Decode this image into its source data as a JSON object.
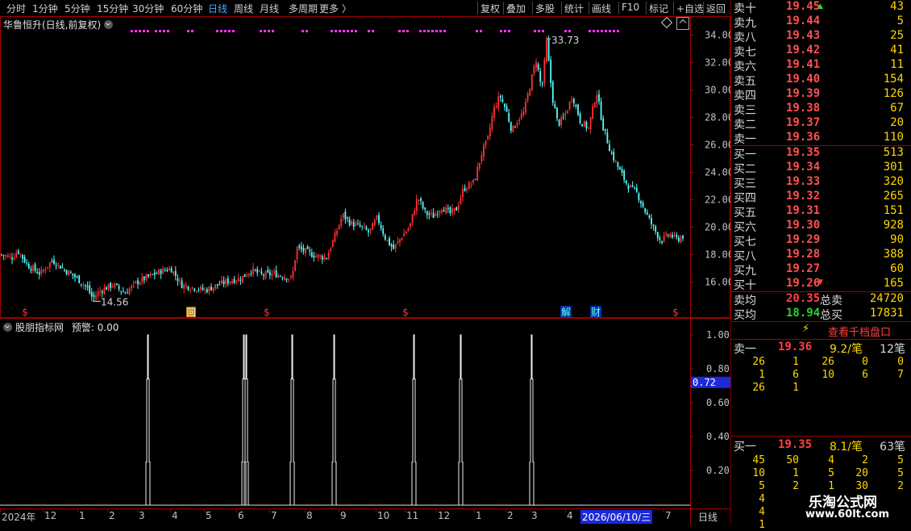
{
  "toolbar": {
    "periods": [
      "分时",
      "1分钟",
      "5分钟",
      "15分钟",
      "30分钟",
      "60分钟",
      "日线",
      "周线",
      "月线",
      "多周期",
      "更多 〉"
    ],
    "active": "日线",
    "tools": [
      "复权",
      "叠加",
      "多股",
      "统计",
      "画线",
      "F10",
      "标记",
      "+自选",
      "返回"
    ]
  },
  "main_chart": {
    "title": "华鲁恒升(日线,前复权)",
    "high_label": "33.73",
    "low_label": "14.56",
    "markers": [
      "$",
      "回",
      "$",
      "$",
      "解",
      "财",
      "$"
    ]
  },
  "indicator": {
    "title": "股朋指标网",
    "warn_label": "预警: 0.00",
    "current_value": "0.72"
  },
  "bottom_axis": {
    "labels": [
      "2024年",
      "12",
      "1",
      "2",
      "3",
      "4",
      "5",
      "6",
      "7",
      "8",
      "9",
      "10",
      "11",
      "12",
      "1",
      "2",
      "3",
      "4",
      "2026/06/10/三",
      "7"
    ],
    "period": "日线"
  },
  "chart_data": {
    "type": "candlestick",
    "title": "华鲁恒升(日线,前复权)",
    "price_axis": {
      "ticks": [
        "34.00",
        "32.00",
        "30.00",
        "28.00",
        "26.00",
        "24.00",
        "22.00",
        "20.00",
        "18.00",
        "16.00"
      ],
      "ylim": [
        14.5,
        34.5
      ]
    },
    "indicator_axis": {
      "ticks": [
        "1.00",
        "0.80",
        "0.60",
        "0.40",
        "0.20"
      ],
      "ylim": [
        0,
        1
      ]
    },
    "up_color": "#ff3232",
    "down_color": "#54ffff",
    "close_path": [
      [
        0,
        18.0
      ],
      [
        15,
        17.8
      ],
      [
        22,
        18.3
      ],
      [
        35,
        17.2
      ],
      [
        50,
        16.6
      ],
      [
        65,
        17.6
      ],
      [
        80,
        16.9
      ],
      [
        95,
        16.3
      ],
      [
        108,
        15.6
      ],
      [
        115,
        14.8
      ],
      [
        125,
        15.4
      ],
      [
        140,
        15.8
      ],
      [
        155,
        15.2
      ],
      [
        170,
        16.0
      ],
      [
        185,
        16.4
      ],
      [
        200,
        16.8
      ],
      [
        212,
        17.0
      ],
      [
        225,
        15.8
      ],
      [
        240,
        15.6
      ],
      [
        255,
        15.4
      ],
      [
        270,
        15.8
      ],
      [
        285,
        16.1
      ],
      [
        300,
        16.3
      ],
      [
        312,
        16.9
      ],
      [
        325,
        16.5
      ],
      [
        340,
        16.6
      ],
      [
        355,
        16.4
      ],
      [
        362,
        16.2
      ],
      [
        368,
        18.5
      ],
      [
        380,
        18.2
      ],
      [
        392,
        17.9
      ],
      [
        405,
        17.8
      ],
      [
        415,
        19.3
      ],
      [
        425,
        20.9
      ],
      [
        435,
        20.3
      ],
      [
        448,
        20.0
      ],
      [
        458,
        19.6
      ],
      [
        468,
        20.7
      ],
      [
        478,
        19.2
      ],
      [
        488,
        18.4
      ],
      [
        498,
        19.3
      ],
      [
        508,
        20.0
      ],
      [
        518,
        22.2
      ],
      [
        528,
        21.0
      ],
      [
        538,
        20.8
      ],
      [
        548,
        21.5
      ],
      [
        558,
        21.0
      ],
      [
        566,
        21.3
      ],
      [
        575,
        22.8
      ],
      [
        588,
        23.3
      ],
      [
        598,
        25.5
      ],
      [
        605,
        26.4
      ],
      [
        612,
        28.5
      ],
      [
        620,
        29.6
      ],
      [
        628,
        28.5
      ],
      [
        635,
        27.0
      ],
      [
        642,
        27.8
      ],
      [
        650,
        28.4
      ],
      [
        658,
        30.5
      ],
      [
        665,
        32.2
      ],
      [
        672,
        30.0
      ],
      [
        678,
        33.5
      ],
      [
        685,
        29.5
      ],
      [
        692,
        27.5
      ],
      [
        700,
        28.0
      ],
      [
        710,
        29.6
      ],
      [
        720,
        27.7
      ],
      [
        730,
        27.2
      ],
      [
        740,
        29.9
      ],
      [
        748,
        27.3
      ],
      [
        758,
        25.4
      ],
      [
        768,
        24.2
      ],
      [
        778,
        23.1
      ],
      [
        790,
        22.5
      ],
      [
        800,
        21.2
      ],
      [
        810,
        20.0
      ],
      [
        820,
        19.0
      ],
      [
        830,
        19.5
      ],
      [
        840,
        19.1
      ],
      [
        848,
        19.4
      ]
    ],
    "indicator_spikes_rel_x": [
      183,
      302,
      305,
      362,
      414,
      513,
      571,
      659
    ]
  },
  "orderbook": {
    "asks": [
      {
        "label": "卖十",
        "price": "19.45",
        "vol": "43"
      },
      {
        "label": "卖九",
        "price": "19.44",
        "vol": "5"
      },
      {
        "label": "卖八",
        "price": "19.43",
        "vol": "25"
      },
      {
        "label": "卖七",
        "price": "19.42",
        "vol": "41"
      },
      {
        "label": "卖六",
        "price": "19.41",
        "vol": "11"
      },
      {
        "label": "卖五",
        "price": "19.40",
        "vol": "154"
      },
      {
        "label": "卖四",
        "price": "19.39",
        "vol": "126"
      },
      {
        "label": "卖三",
        "price": "19.38",
        "vol": "67"
      },
      {
        "label": "卖二",
        "price": "19.37",
        "vol": "20"
      },
      {
        "label": "卖一",
        "price": "19.36",
        "vol": "110"
      }
    ],
    "bids": [
      {
        "label": "买一",
        "price": "19.35",
        "vol": "513"
      },
      {
        "label": "买二",
        "price": "19.34",
        "vol": "301"
      },
      {
        "label": "买三",
        "price": "19.33",
        "vol": "320"
      },
      {
        "label": "买四",
        "price": "19.32",
        "vol": "265"
      },
      {
        "label": "买五",
        "price": "19.31",
        "vol": "151"
      },
      {
        "label": "买六",
        "price": "19.30",
        "vol": "928"
      },
      {
        "label": "买七",
        "price": "19.29",
        "vol": "90"
      },
      {
        "label": "买八",
        "price": "19.28",
        "vol": "388"
      },
      {
        "label": "买九",
        "price": "19.27",
        "vol": "60"
      },
      {
        "label": "买十",
        "price": "19.26",
        "vol": "165"
      }
    ],
    "sell_avg": {
      "label": "卖均",
      "price": "20.35",
      "tlabel": "总卖",
      "vol": "24720"
    },
    "buy_avg": {
      "label": "买均",
      "price": "18.94",
      "tlabel": "总买",
      "vol": "17831"
    },
    "view_btn": "查看千档盘口",
    "sell1": {
      "label": "卖一",
      "price": "19.36",
      "per": "9.2/笔",
      "count": "12笔"
    },
    "sell1_grid": [
      [
        "26",
        "1",
        "26",
        "0",
        "0"
      ],
      [
        "1",
        "6",
        "10",
        "6",
        "7"
      ],
      [
        "26",
        "1",
        "",
        "",
        ""
      ]
    ],
    "buy1": {
      "label": "买一",
      "price": "19.35",
      "per": "8.1/笔",
      "count": "63笔"
    },
    "buy1_grid": [
      [
        "45",
        "50",
        "4",
        "2",
        "5"
      ],
      [
        "10",
        "1",
        "5",
        "20",
        "5"
      ],
      [
        "5",
        "2",
        "1",
        "30",
        "2"
      ],
      [
        "4",
        "",
        "",
        "",
        ""
      ],
      [
        "4",
        "",
        "",
        "",
        ""
      ],
      [
        "1",
        "",
        "",
        "",
        ""
      ]
    ]
  },
  "watermark": {
    "line1": "乐淘公式网",
    "line2": "www.60lt.com"
  }
}
